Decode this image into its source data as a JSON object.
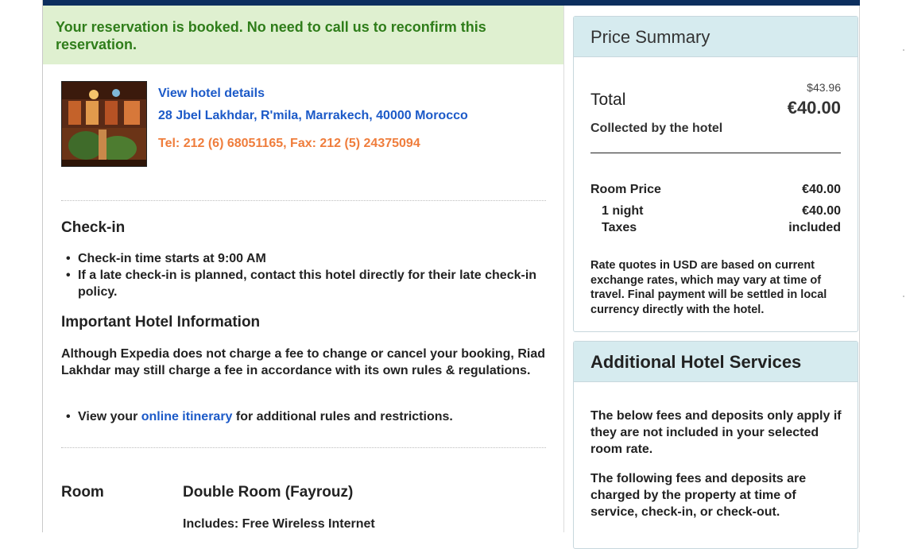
{
  "confirmation": {
    "message": "Your reservation is booked. No need to call us to reconfirm this reservation."
  },
  "hotel": {
    "photo_icon": "hotel-courtyard-photo",
    "details_link": "View hotel details",
    "address": "28 Jbel Lakhdar, R'mila, Marrakech, 40000 Morocco",
    "contact": "Tel: 212 (6) 68051165, Fax: 212 (5) 24375094"
  },
  "checkin": {
    "heading": "Check-in",
    "items": [
      "Check-in time starts at 9:00 AM",
      "If a late check-in is planned, contact this hotel directly for their late check-in policy."
    ]
  },
  "important_info": {
    "heading": "Important Hotel Information",
    "text": "Although Expedia does not charge a fee to change or cancel your booking, Riad Lakhdar may still charge a fee in accordance with its own rules & regulations.",
    "bullet_prefix": "View your",
    "bullet_link": "online itinerary",
    "bullet_suffix": "for additional rules and restrictions."
  },
  "room": {
    "label": "Room",
    "name": "Double Room (Fayrouz)",
    "includes": "Includes: Free Wireless Internet"
  },
  "price_summary": {
    "title": "Price Summary",
    "total_label": "Total",
    "original_price": "$43.96",
    "total_price": "€40.00",
    "collected": "Collected by the hotel",
    "room_price_label": "Room Price",
    "room_price_value": "€40.00",
    "nights_label": "1 night",
    "nights_value": "€40.00",
    "taxes_label": "Taxes",
    "taxes_value": "included",
    "note": "Rate quotes in USD are based on current exchange rates, which may vary at time of travel. Final payment will be settled in local currency directly with the hotel."
  },
  "services": {
    "title": "Additional Hotel Services",
    "p1": "The below fees and deposits only apply if they are not included in your selected room rate.",
    "p2": "The following fees and deposits are charged by the property at time of service, check-in, or check-out."
  },
  "colors": {
    "top_bar": "#0c2e5e",
    "banner_bg": "#dff0d0",
    "banner_text": "#2f7d1a",
    "link": "#1c5ac8",
    "contact": "#ef7d3c",
    "box_header": "#d6ebef"
  }
}
